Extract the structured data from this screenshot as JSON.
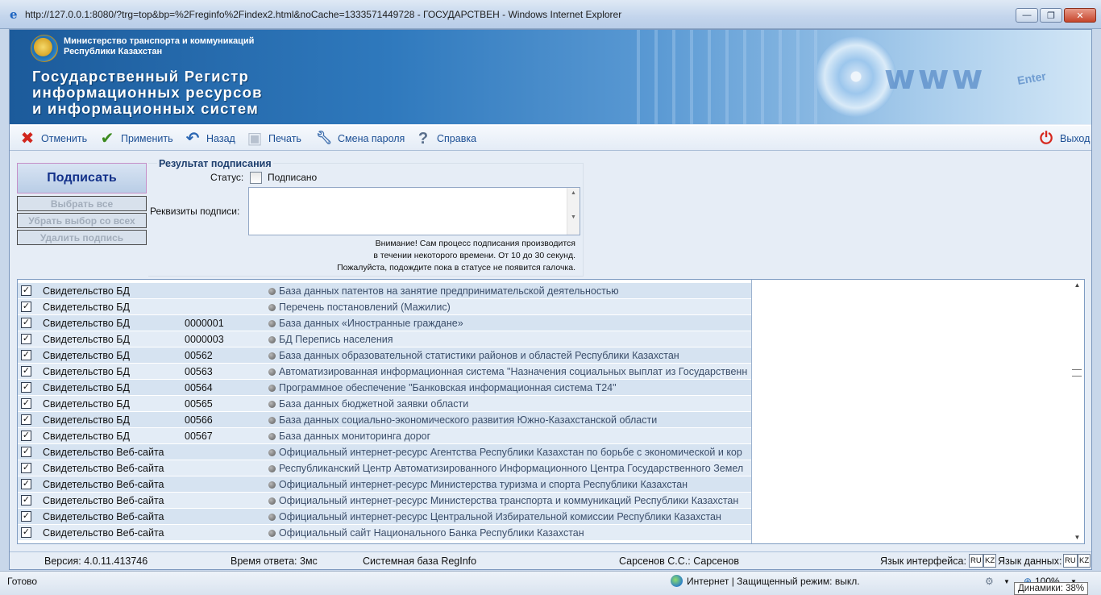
{
  "browser": {
    "title": "http://127.0.0.1:8080/?trg=top&bp=%2Freginfo%2Findex2.html&noCache=1333571449728 - ГОСУДАРСТВЕН - Windows Internet Explorer",
    "minimize": "—",
    "maximize": "❐",
    "close": "✕",
    "status_text": "Готово",
    "zone_text": "Интернет | Защищенный режим: выкл.",
    "zoom": "100%",
    "tooltip": "Динамики: 38%"
  },
  "banner": {
    "ministry_line1": "Министерство транспорта и коммуникаций",
    "ministry_line2": "Республики Казахстан",
    "registry_line1": "Государственный Регистр",
    "registry_line2": "информационных ресурсов",
    "registry_line3": "и  информационных систем",
    "www": "www",
    "enter": "Enter"
  },
  "toolbar": {
    "cancel": "Отменить",
    "apply": "Применить",
    "back": "Назад",
    "print": "Печать",
    "change_password": "Смена пароля",
    "help": "Справка",
    "exit": "Выход"
  },
  "sign": {
    "sign_button": "Подписать",
    "select_all": "Выбрать все",
    "deselect_all": "Убрать выбор со всех",
    "delete_signature": "Удалить подпись",
    "result_legend": "Результат подписания",
    "status_label": "Статус:",
    "status_value": "Подписано",
    "requisites_label": "Реквизиты подписи:",
    "warning_line1": "Внимание! Сам процесс подписания производится",
    "warning_line2": "в течении некоторого времени. От 10 до 30 секунд.",
    "warning_line3": "Пожалуйста, подождите пока в статусе не появится галочка."
  },
  "rows": [
    {
      "type": "Свидетельство БД",
      "num": "",
      "name": "База данных патентов на занятие предпринимательской деятельностью"
    },
    {
      "type": "Свидетельство БД",
      "num": "",
      "name": "Перечень постановлений (Мажилис)"
    },
    {
      "type": "Свидетельство БД",
      "num": "0000001",
      "name": "База данных «Иностранные граждане»"
    },
    {
      "type": "Свидетельство БД",
      "num": "0000003",
      "name": "БД Перепись населения"
    },
    {
      "type": "Свидетельство БД",
      "num": "00562",
      "name": "База данных образовательной статистики районов и областей Республики Казахстан"
    },
    {
      "type": "Свидетельство БД",
      "num": "00563",
      "name": "Автоматизированная информационная система \"Назначения социальных выплат из Государственн"
    },
    {
      "type": "Свидетельство БД",
      "num": "00564",
      "name": "Программное обеспечение \"Банковская информационная система Т24\""
    },
    {
      "type": "Свидетельство БД",
      "num": "00565",
      "name": "База данных бюджетной заявки области"
    },
    {
      "type": "Свидетельство БД",
      "num": "00566",
      "name": "База данных социально-экономического развития Южно-Казахстанской области"
    },
    {
      "type": "Свидетельство БД",
      "num": "00567",
      "name": "База данных мониторинга дорог"
    },
    {
      "type": "Свидетельство Веб-сайта",
      "num": "",
      "name": "Официальный интернет-ресурс Агентства Республики Казахстан по борьбе с экономической и кор"
    },
    {
      "type": "Свидетельство Веб-сайта",
      "num": "",
      "name": "Республиканский Центр Автоматизированного Информационного Центра Государственного Земел"
    },
    {
      "type": "Свидетельство Веб-сайта",
      "num": "",
      "name": "Официальный интернет-ресурс Министерства туризма и спорта Республики Казахстан"
    },
    {
      "type": "Свидетельство Веб-сайта",
      "num": "",
      "name": "Официальный интернет-ресурс Министерства транспорта и коммуникаций Республики Казахстан"
    },
    {
      "type": "Свидетельство Веб-сайта",
      "num": "",
      "name": "Официальный интернет-ресурс Центральной Избирательной комиссии Республики Казахстан"
    },
    {
      "type": "Свидетельство Веб-сайта",
      "num": "",
      "name": "Официальный сайт Национального Банка Республики Казахстан"
    }
  ],
  "footer": {
    "version": "Версия: 4.0.11.413746",
    "response_time": "Время ответа: 3мс",
    "system_base": "Системная база RegInfo",
    "user": "Сарсенов С.С.: Сарсенов",
    "ui_lang_label": "Язык интерфейса:",
    "data_lang_label": "Язык данных:",
    "ru": "RU",
    "kz": "KZ"
  }
}
